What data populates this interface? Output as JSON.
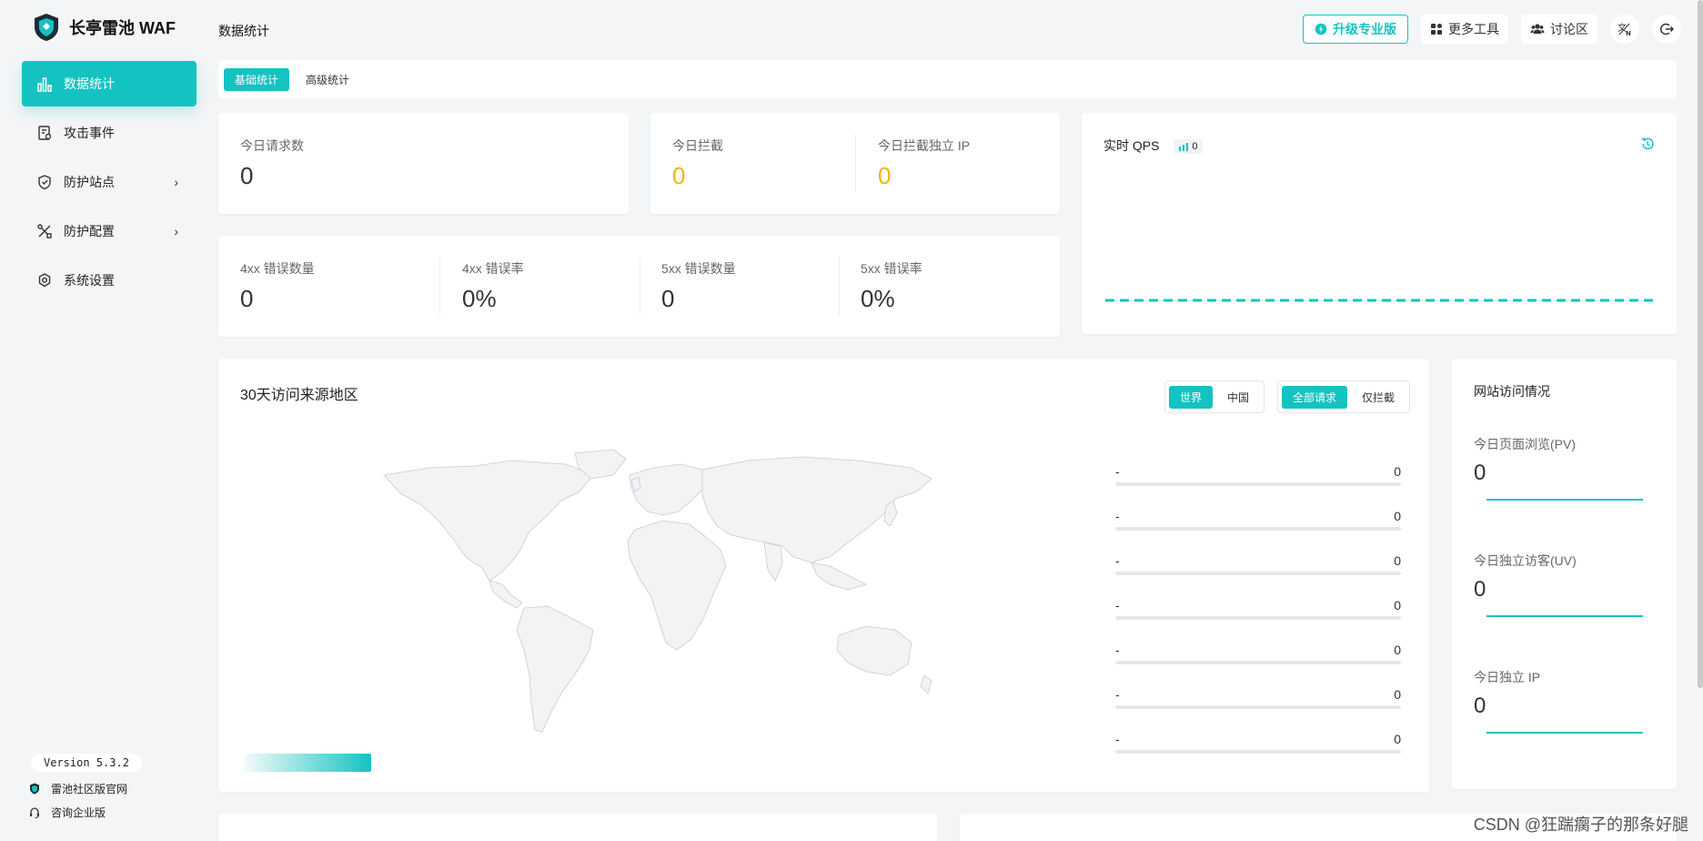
{
  "app": {
    "name": "长亭雷池 WAF"
  },
  "sidebar": {
    "items": [
      {
        "label": "数据统计",
        "icon": "bar-chart-icon",
        "active": true
      },
      {
        "label": "攻击事件",
        "icon": "document-icon",
        "active": false
      },
      {
        "label": "防护站点",
        "icon": "shield-icon",
        "active": false,
        "has_submenu": true
      },
      {
        "label": "防护配置",
        "icon": "tools-icon",
        "active": false,
        "has_submenu": true
      },
      {
        "label": "系统设置",
        "icon": "gear-icon",
        "active": false
      }
    ],
    "chevron": "›",
    "version": "Version 5.3.2",
    "links": [
      {
        "label": "雷池社区版官网",
        "icon": "shield-icon"
      },
      {
        "label": "咨询企业版",
        "icon": "headset-icon"
      }
    ]
  },
  "header": {
    "title": "数据统计",
    "upgrade_label": "升级专业版",
    "tools_label": "更多工具",
    "forum_label": "讨论区"
  },
  "tabs": [
    {
      "label": "基础统计",
      "active": true
    },
    {
      "label": "高级统计",
      "active": false
    }
  ],
  "stats": {
    "requests": {
      "label": "今日请求数",
      "value": "0"
    },
    "blocked": {
      "label": "今日拦截",
      "value": "0"
    },
    "blocked_ip": {
      "label": "今日拦截独立 IP",
      "value": "0"
    },
    "err4xx_count": {
      "label": "4xx 错误数量",
      "value": "0"
    },
    "err4xx_rate": {
      "label": "4xx 错误率",
      "value": "0%"
    },
    "err5xx_count": {
      "label": "5xx 错误数量",
      "value": "0"
    },
    "err5xx_rate": {
      "label": "5xx 错误率",
      "value": "0%"
    }
  },
  "qps": {
    "label": "实时 QPS",
    "value": "0"
  },
  "map": {
    "title": "30天访问来源地区",
    "scope_options": [
      "世界",
      "中国"
    ],
    "scope_selected": "世界",
    "filter_options": [
      "全部请求",
      "仅拦截"
    ],
    "filter_selected": "全部请求",
    "ranking": [
      {
        "label": "-",
        "value": "0"
      },
      {
        "label": "-",
        "value": "0"
      },
      {
        "label": "-",
        "value": "0"
      },
      {
        "label": "-",
        "value": "0"
      },
      {
        "label": "-",
        "value": "0"
      },
      {
        "label": "-",
        "value": "0"
      },
      {
        "label": "-",
        "value": "0"
      }
    ]
  },
  "visits": {
    "title": "网站访问情况",
    "pv": {
      "label": "今日页面浏览(PV)",
      "value": "0"
    },
    "uv": {
      "label": "今日独立访客(UV)",
      "value": "0"
    },
    "ip": {
      "label": "今日独立 IP",
      "value": "0"
    }
  },
  "watermark": "CSDN @狂踹瘸子的那条好腿",
  "colors": {
    "accent": "#14c3c1",
    "warning": "#f5b400"
  }
}
